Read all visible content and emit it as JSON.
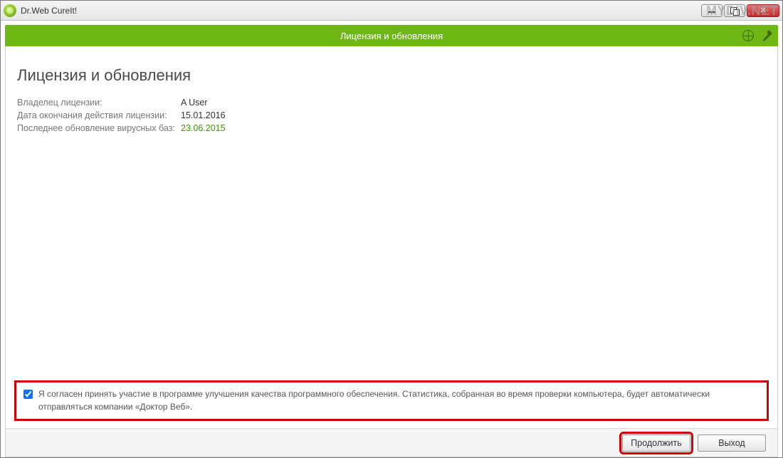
{
  "window": {
    "title": "Dr.Web CureIt!"
  },
  "watermark": "MYDIV.NET",
  "header": {
    "title": "Лицензия и обновления"
  },
  "page": {
    "heading": "Лицензия и обновления"
  },
  "info": {
    "owner_label": "Владелец лицензии:",
    "owner_value": "A User",
    "expiry_label": "Дата окончания действия лицензии:",
    "expiry_value": "15.01.2016",
    "update_label": "Последнее обновление вирусных баз:",
    "update_value": "23.06.2015"
  },
  "consent": {
    "text": "Я согласен принять участие в программе улучшения качества программного обеспечения. Статистика, собранная во время проверки компьютера, будет автоматически отправляться компании «Доктор Веб»."
  },
  "buttons": {
    "continue": "Продолжить",
    "exit": "Выход"
  }
}
